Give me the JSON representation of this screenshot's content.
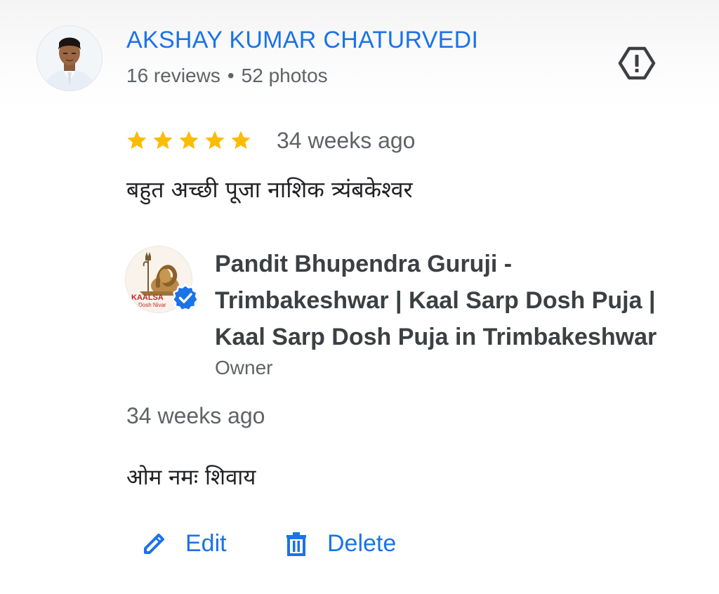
{
  "review": {
    "reviewer_name": "AKSHAY KUMAR CHATURVEDI",
    "reviews_count": "16 reviews",
    "separator": "•",
    "photos_count": "52 photos",
    "rating": 5,
    "rating_max": 5,
    "time": "34 weeks ago",
    "text": "बहुत अच्छी पूजा नाशिक त्र्यंबकेश्वर"
  },
  "owner_response": {
    "name": "Pandit Bhupendra Guruji - Trimbakeshwar | Kaal Sarp Dosh Puja | Kaal Sarp Dosh Puja in Trimbakeshwar",
    "label": "Owner",
    "logo_text_line1": "KAALSA",
    "logo_text_line2": "Dosh Nivar",
    "time": "34 weeks ago",
    "text": "ओम नमः शिवाय"
  },
  "actions": {
    "edit_label": "Edit",
    "delete_label": "Delete"
  },
  "colors": {
    "accent": "#1a73e8",
    "star": "#fbbc04",
    "secondary_text": "#5f6368",
    "primary_text": "#202124"
  },
  "icons": {
    "report": "report-flag-icon",
    "verified": "verified-badge-icon",
    "edit": "pencil-icon",
    "delete": "trash-icon",
    "star": "star-icon"
  }
}
